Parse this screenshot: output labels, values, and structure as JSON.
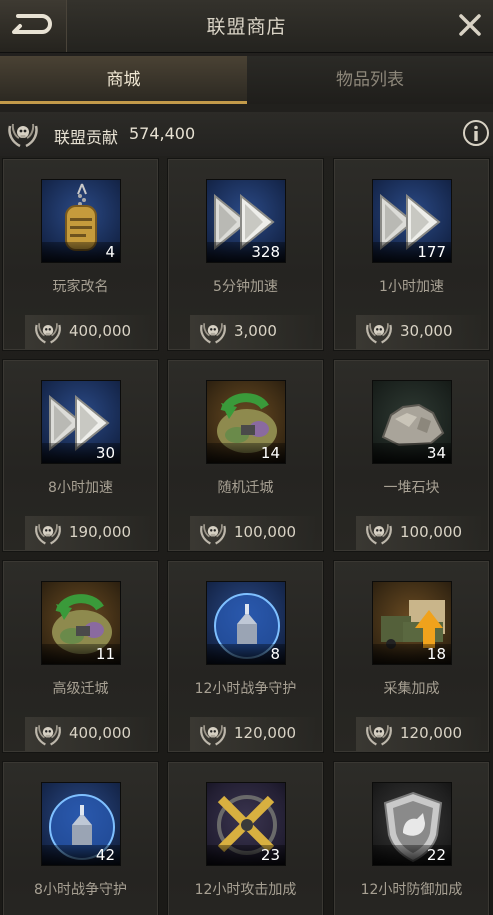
{
  "header": {
    "title": "联盟商店",
    "back_icon": "back-arrow-icon",
    "close_icon": "close-icon"
  },
  "tabs": [
    {
      "label": "商城",
      "active": true
    },
    {
      "label": "物品列表",
      "active": false
    }
  ],
  "contribution": {
    "label": "联盟贡献",
    "value": "574,400",
    "icon": "alliance-emblem-icon",
    "info_icon": "info-icon"
  },
  "items": [
    {
      "name": "玩家改名",
      "qty": "4",
      "price": "400,000",
      "icon": "dog-tag-icon"
    },
    {
      "name": "5分钟加速",
      "qty": "328",
      "price": "3,000",
      "icon": "speedup-icon"
    },
    {
      "name": "1小时加速",
      "qty": "177",
      "price": "30,000",
      "icon": "speedup-icon"
    },
    {
      "name": "8小时加速",
      "qty": "30",
      "price": "190,000",
      "icon": "speedup-icon"
    },
    {
      "name": "随机迁城",
      "qty": "14",
      "price": "100,000",
      "icon": "random-relocate-icon"
    },
    {
      "name": "一堆石块",
      "qty": "34",
      "price": "100,000",
      "icon": "stone-pile-icon"
    },
    {
      "name": "高级迁城",
      "qty": "11",
      "price": "400,000",
      "icon": "advanced-relocate-icon"
    },
    {
      "name": "12小时战争守护",
      "qty": "8",
      "price": "120,000",
      "icon": "shield-dome-icon"
    },
    {
      "name": "采集加成",
      "qty": "18",
      "price": "120,000",
      "icon": "gather-boost-icon"
    },
    {
      "name": "8小时战争守护",
      "qty": "42",
      "price": "",
      "icon": "shield-dome-icon"
    },
    {
      "name": "12小时攻击加成",
      "qty": "23",
      "price": "",
      "icon": "attack-boost-icon"
    },
    {
      "name": "12小时防御加成",
      "qty": "22",
      "price": "",
      "icon": "defense-boost-icon"
    }
  ],
  "colors": {
    "accent_gold": "#c29a4a",
    "speedup_blue": "#1d3a78"
  }
}
